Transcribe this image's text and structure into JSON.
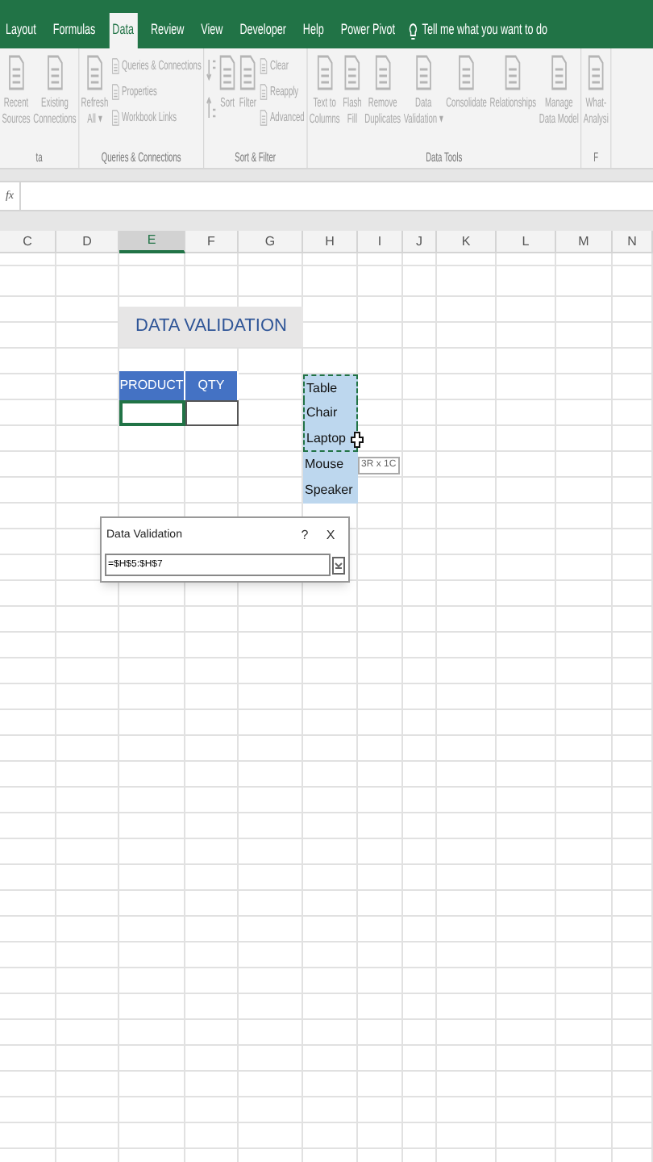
{
  "ribbon_tabs": [
    {
      "label": "Layout",
      "selected": false
    },
    {
      "label": "Formulas",
      "selected": false
    },
    {
      "label": "Data",
      "selected": true
    },
    {
      "label": "Review",
      "selected": false
    },
    {
      "label": "View",
      "selected": false
    },
    {
      "label": "Developer",
      "selected": false
    },
    {
      "label": "Help",
      "selected": false
    },
    {
      "label": "Power Pivot",
      "selected": false
    }
  ],
  "tell_me": "Tell me what you want to do",
  "ribbon": {
    "disabled": true,
    "groups": [
      {
        "label": "ta",
        "buttons": [
          {
            "kind": "large",
            "label": "Recent\nSources"
          },
          {
            "kind": "large",
            "label": "Existing\nConnections"
          }
        ]
      },
      {
        "label": "Queries & Connections",
        "buttons": [
          {
            "kind": "large",
            "label": "Refresh\nAll ▾"
          },
          {
            "kind": "small",
            "label": "Queries & Connections"
          },
          {
            "kind": "small",
            "label": "Properties"
          },
          {
            "kind": "small",
            "label": "Workbook Links"
          }
        ]
      },
      {
        "label": "Sort & Filter",
        "buttons": [
          {
            "kind": "sort",
            "label": "Sort"
          },
          {
            "kind": "large",
            "label": "Filter"
          },
          {
            "kind": "small",
            "label": "Clear"
          },
          {
            "kind": "small",
            "label": "Reapply"
          },
          {
            "kind": "small",
            "label": "Advanced"
          }
        ]
      },
      {
        "label": "Data Tools",
        "buttons": [
          {
            "kind": "large",
            "label": "Text to\nColumns"
          },
          {
            "kind": "large",
            "label": "Flash\nFill"
          },
          {
            "kind": "large",
            "label": "Remove\nDuplicates"
          },
          {
            "kind": "large",
            "label": "Data\nValidation ▾"
          },
          {
            "kind": "large",
            "label": "Consolidate"
          },
          {
            "kind": "large",
            "label": "Relationships"
          },
          {
            "kind": "large",
            "label": "Manage\nData Model"
          }
        ]
      },
      {
        "label": "F",
        "buttons": [
          {
            "kind": "large",
            "label": "What-\nAnalysi"
          }
        ]
      }
    ]
  },
  "formula_bar": {
    "fx": "fx"
  },
  "columns": [
    {
      "label": "C",
      "selected": false
    },
    {
      "label": "D",
      "selected": false
    },
    {
      "label": "E",
      "selected": true
    },
    {
      "label": "F",
      "selected": false
    },
    {
      "label": "G",
      "selected": false
    },
    {
      "label": "H",
      "selected": false
    },
    {
      "label": "I",
      "selected": false
    },
    {
      "label": "J",
      "selected": false
    },
    {
      "label": "K",
      "selected": false
    },
    {
      "label": "L",
      "selected": false
    },
    {
      "label": "M",
      "selected": false
    },
    {
      "label": "N",
      "selected": false
    }
  ],
  "sheet": {
    "title": "DATA VALIDATION",
    "table_headers": [
      "PRODUCT",
      "QTY"
    ],
    "list": [
      {
        "text": "Table",
        "selected": true
      },
      {
        "text": "Chair",
        "selected": true
      },
      {
        "text": "Laptop",
        "selected": true
      },
      {
        "text": "Mouse",
        "selected": false
      },
      {
        "text": "Speaker",
        "selected": false
      }
    ],
    "size_tip": "3R x 1C"
  },
  "dialog": {
    "title": "Data Validation",
    "help": "?",
    "close": "X",
    "value": "=$H$5:$H$7"
  }
}
